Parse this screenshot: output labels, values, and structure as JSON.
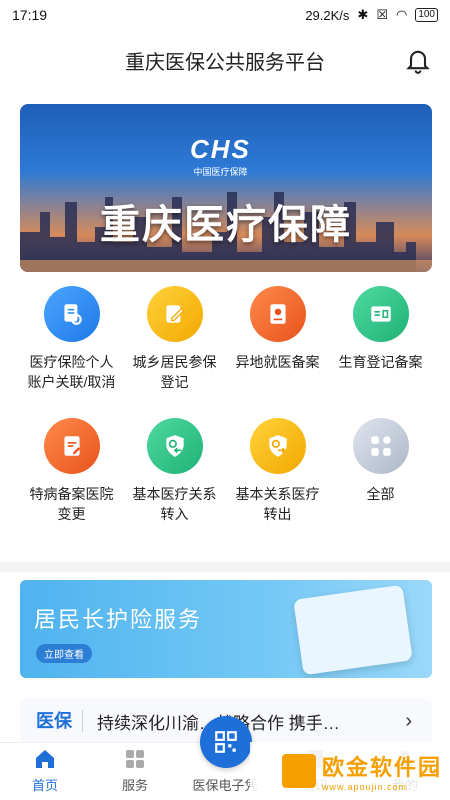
{
  "status": {
    "time": "17:19",
    "network_speed": "29.2K/s",
    "battery": "100"
  },
  "header": {
    "title": "重庆医保公共服务平台"
  },
  "banner": {
    "logo": "CHS",
    "logo_sub": "中国医疗保障",
    "title": "重庆医疗保障"
  },
  "services": [
    {
      "label": "医疗保险个人账户关联/取消",
      "icon": "document-link-icon",
      "color": "#2f8ff0"
    },
    {
      "label": "城乡居民参保登记",
      "icon": "pencil-icon",
      "color": "#f5b400"
    },
    {
      "label": "异地就医备案",
      "icon": "location-card-icon",
      "color": "#f06a30"
    },
    {
      "label": "生育登记备案",
      "icon": "id-card-icon",
      "color": "#2ec48a"
    },
    {
      "label": "特病备案医院变更",
      "icon": "document-edit-icon",
      "color": "#f06a30"
    },
    {
      "label": "基本医疗关系转入",
      "icon": "shield-transfer-in-icon",
      "color": "#2ec48a"
    },
    {
      "label": "基本关系医疗转出",
      "icon": "shield-transfer-out-icon",
      "color": "#f5b400"
    },
    {
      "label": "全部",
      "icon": "grid-all-icon",
      "color": "#c8cfdc"
    }
  ],
  "promo": {
    "title": "居民长护险服务",
    "button": "立即查看"
  },
  "news": {
    "tag": "医保",
    "text": "持续深化川渝…战略合作 携手…"
  },
  "tabs": [
    {
      "label": "首页",
      "icon": "home-icon"
    },
    {
      "label": "服务",
      "icon": "services-icon"
    },
    {
      "label": "医保电子凭",
      "icon": "qr-code-icon"
    },
    {
      "label": "资讯",
      "icon": "news-icon"
    },
    {
      "label": "我的",
      "icon": "profile-icon"
    }
  ],
  "watermark": {
    "text": "欧金软件园",
    "url": "www.apoujin.com"
  }
}
